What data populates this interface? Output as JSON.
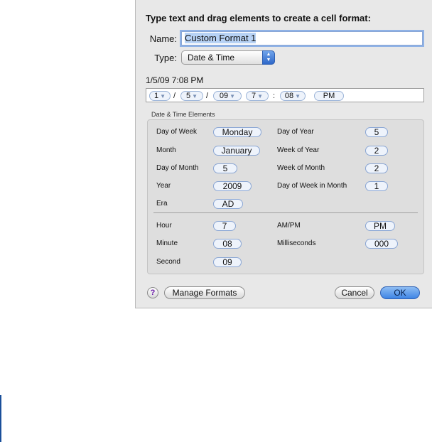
{
  "dialog": {
    "heading": "Type text and drag elements to create a cell format:",
    "name_label": "Name:",
    "name_value": "Custom Format 1",
    "type_label": "Type:",
    "type_value": "Date & Time",
    "preview": "1/5/09 7:08 PM"
  },
  "format_tokens": [
    "1",
    "5",
    "09",
    "7",
    "08",
    "PM"
  ],
  "format_separators": [
    "/",
    "/",
    ":"
  ],
  "elements": {
    "group_label": "Date & Time Elements",
    "date_left": [
      {
        "label": "Day of Week",
        "value": "Monday"
      },
      {
        "label": "Month",
        "value": "January"
      },
      {
        "label": "Day of Month",
        "value": "5"
      },
      {
        "label": "Year",
        "value": "2009"
      },
      {
        "label": "Era",
        "value": "AD"
      }
    ],
    "date_right": [
      {
        "label": "Day of Year",
        "value": "5"
      },
      {
        "label": "Week of Year",
        "value": "2"
      },
      {
        "label": "Week of Month",
        "value": "2"
      },
      {
        "label": "Day of Week in Month",
        "value": "1"
      }
    ],
    "time_left": [
      {
        "label": "Hour",
        "value": "7"
      },
      {
        "label": "Minute",
        "value": "08"
      },
      {
        "label": "Second",
        "value": "09"
      }
    ],
    "time_right": [
      {
        "label": "AM/PM",
        "value": "PM"
      },
      {
        "label": "Milliseconds",
        "value": "000"
      }
    ]
  },
  "buttons": {
    "help": "?",
    "manage": "Manage Formats",
    "cancel": "Cancel",
    "ok": "OK"
  },
  "icons": {
    "type_popup": "up-down-arrows-icon",
    "token_menu": "chevron-down-icon",
    "help": "question-mark-icon"
  }
}
